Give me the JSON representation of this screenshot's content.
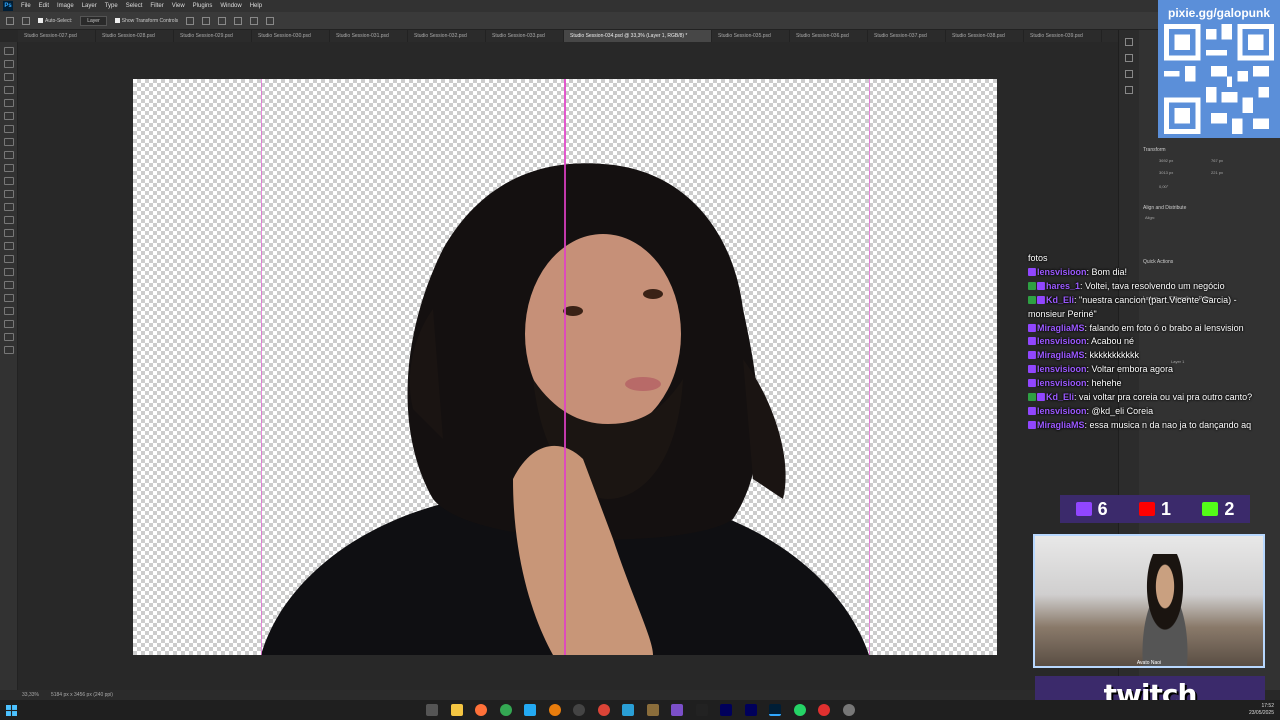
{
  "app": {
    "menu": [
      "File",
      "Edit",
      "Image",
      "Layer",
      "Type",
      "Select",
      "Filter",
      "View",
      "Plugins",
      "Window",
      "Help"
    ]
  },
  "options_bar": {
    "auto_select_label": "Auto-Select:",
    "auto_select_value": "Layer",
    "transform_controls_label": "Show Transform Controls"
  },
  "tabs": [
    {
      "label": "Studio Session-027.psd",
      "active": false
    },
    {
      "label": "Studio Session-028.psd",
      "active": false
    },
    {
      "label": "Studio Session-029.psd",
      "active": false
    },
    {
      "label": "Studio Session-030.psd",
      "active": false
    },
    {
      "label": "Studio Session-031.psd",
      "active": false
    },
    {
      "label": "Studio Session-032.psd",
      "active": false
    },
    {
      "label": "Studio Session-033.psd",
      "active": false
    },
    {
      "label": "Studio Session-034.psd @ 33,3% (Layer 1, RGB/8) *",
      "active": true
    },
    {
      "label": "Studio Session-035.psd",
      "active": false
    },
    {
      "label": "Studio Session-036.psd",
      "active": false
    },
    {
      "label": "Studio Session-037.psd",
      "active": false
    },
    {
      "label": "Studio Session-038.psd",
      "active": false
    },
    {
      "label": "Studio Session-039.psd",
      "active": false
    }
  ],
  "status": {
    "zoom": "33,33%",
    "doc_size": "5184 px x 3456 px (240 ppi)"
  },
  "panel": {
    "properties_title": "Transform",
    "w": "3692 px",
    "h": "3013 px",
    "x": "767 px",
    "y": "221 px",
    "angle": "0,00°",
    "align_title": "Align and Distribute",
    "align_label": "Align:",
    "quick_actions": "Quick Actions",
    "layers_tabs": [
      "Layers",
      "Channels",
      "Paths"
    ],
    "layer_name": "Layer 1"
  },
  "overlay": {
    "pixie_url": "pixie.gg/galopunk",
    "counters": [
      {
        "platform": "twitch",
        "value": "6",
        "color": "#9146ff"
      },
      {
        "platform": "youtube",
        "value": "1",
        "color": "#ff0000"
      },
      {
        "platform": "kick",
        "value": "2",
        "color": "#53fc18"
      }
    ],
    "webcam_caption": "Avato Naoi",
    "twitch_logo": "twitch"
  },
  "chat": [
    {
      "user": "",
      "text": "fotos"
    },
    {
      "user": "lensvisioon",
      "text": ": Bom dia!"
    },
    {
      "user": "hares_1",
      "text": ": Voltei, tava resolvendo um negócio"
    },
    {
      "user": "Kd_Eli",
      "text": ": \"nuestra cancion (part.Vicente Garcia) - monsieur Periné\""
    },
    {
      "user": "MiragliaMS",
      "text": ": falando em foto ó o brabo ai lensvision"
    },
    {
      "user": "lensvisioon",
      "text": ": Acabou né"
    },
    {
      "user": "MiragliaMS",
      "text": ": kkkkkkkkkkk"
    },
    {
      "user": "lensvisioon",
      "text": ": Voltar embora agora"
    },
    {
      "user": "lensvisioon",
      "text": ": hehehe"
    },
    {
      "user": "Kd_Eli",
      "text": ": vai voltar pra coreia ou vai pra outro canto?"
    },
    {
      "user": "lensvisioon",
      "text": ": @kd_eli Coreia"
    },
    {
      "user": "MiragliaMS",
      "text": ": essa musica n da nao ja to dançando aq"
    }
  ],
  "taskbar": {
    "time": "17:52",
    "date": "23/05/2025"
  },
  "colors": {
    "accent": "#9146ff",
    "guide": "#e040c8",
    "qr_bg": "#5b8fd9"
  }
}
